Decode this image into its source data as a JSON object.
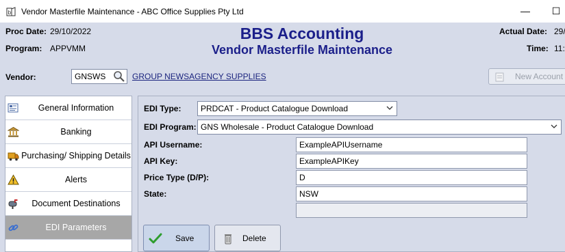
{
  "window": {
    "title": "Vendor Masterfile Maintenance - ABC Office Supplies Pty Ltd",
    "minimize": "—",
    "maximize": "☐"
  },
  "header": {
    "proc_date_label": "Proc Date:",
    "proc_date": "29/10/2022",
    "program_label": "Program:",
    "program": "APPVMM",
    "app_name": "BBS Accounting",
    "screen_name": "Vendor Masterfile Maintenance",
    "actual_date_label": "Actual Date:",
    "actual_date": "29/",
    "time_label": "Time:",
    "time": "11:"
  },
  "vendor": {
    "label": "Vendor:",
    "code": "GNSWS",
    "name": "GROUP NEWSAGENCY SUPPLIES",
    "new_account_label": "New Account"
  },
  "sidebar": {
    "items": [
      {
        "label": "General Information",
        "icon": "form-icon"
      },
      {
        "label": "Banking",
        "icon": "bank-icon"
      },
      {
        "label": "Purchasing/ Shipping Details",
        "icon": "truck-icon"
      },
      {
        "label": "Alerts",
        "icon": "warning-icon"
      },
      {
        "label": "Document Destinations",
        "icon": "mailbox-icon"
      },
      {
        "label": "EDI Parameters",
        "icon": "link-icon",
        "active": true
      }
    ]
  },
  "edi": {
    "type_label": "EDI Type:",
    "type_value": "PRDCAT - Product Catalogue Download",
    "program_label": "EDI Program:",
    "program_value": "GNS Wholesale - Product Catalogue Download",
    "api_username_label": "API Username:",
    "api_username": "ExampleAPIUsername",
    "api_key_label": "API Key:",
    "api_key": "ExampleAPIKey",
    "price_type_label": "Price Type (D/P):",
    "price_type": "D",
    "state_label": "State:",
    "state": "NSW",
    "extra_field": ""
  },
  "actions": {
    "save_label": "Save",
    "delete_label": "Delete"
  },
  "colors": {
    "brand": "#1b1f8a",
    "background": "#d6dbe9",
    "active_tab": "#a7a7a7",
    "save_check": "#2e9d2e"
  }
}
